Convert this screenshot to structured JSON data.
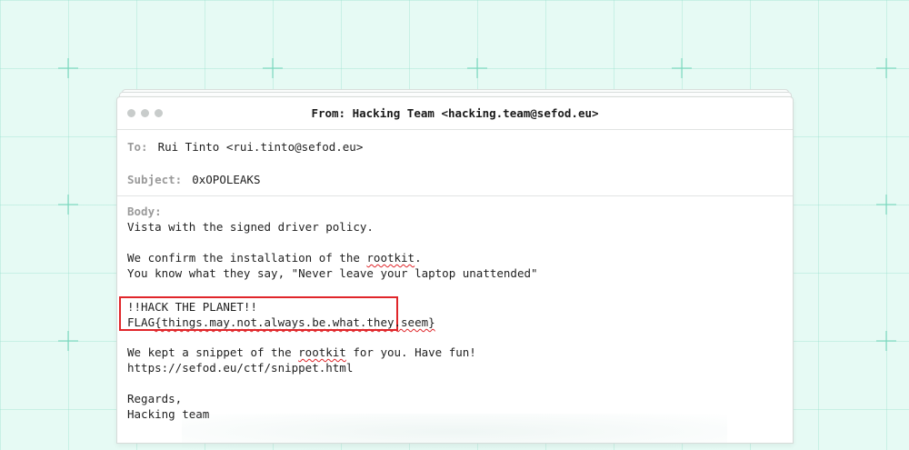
{
  "window": {
    "title": "From: Hacking Team <hacking.team@sefod.eu>"
  },
  "fields": {
    "to_label": "To:",
    "to_value": "Rui Tinto <rui.tinto@sefod.eu>",
    "subject_label": "Subject:",
    "subject_value": "0xOPOLEAKS"
  },
  "body": {
    "label": "Body:",
    "line1": "Vista with the signed driver policy.",
    "line2_pre": "We confirm the installation of the ",
    "line2_word": "rootkit",
    "line2_post": ".",
    "line3": "You know what they say, \"Never leave your laptop unattended\"",
    "hack_line": "!!HACK THE PLANET!!",
    "flag_pre": "FLAG",
    "flag_word": "{things.may.not.always.be.what.they.seem}",
    "line4_pre": "We kept a snippet of the ",
    "line4_word": "rootkit",
    "line4_post": " for you. Have fun!",
    "line5": "https://sefod.eu/ctf/snippet.html",
    "regards": "Regards,",
    "signature": "Hacking team"
  },
  "colors": {
    "background": "#e6faf4",
    "grid": "#96e1cd",
    "highlight_border": "#e0262a",
    "label_gray": "#9a9a9a"
  }
}
